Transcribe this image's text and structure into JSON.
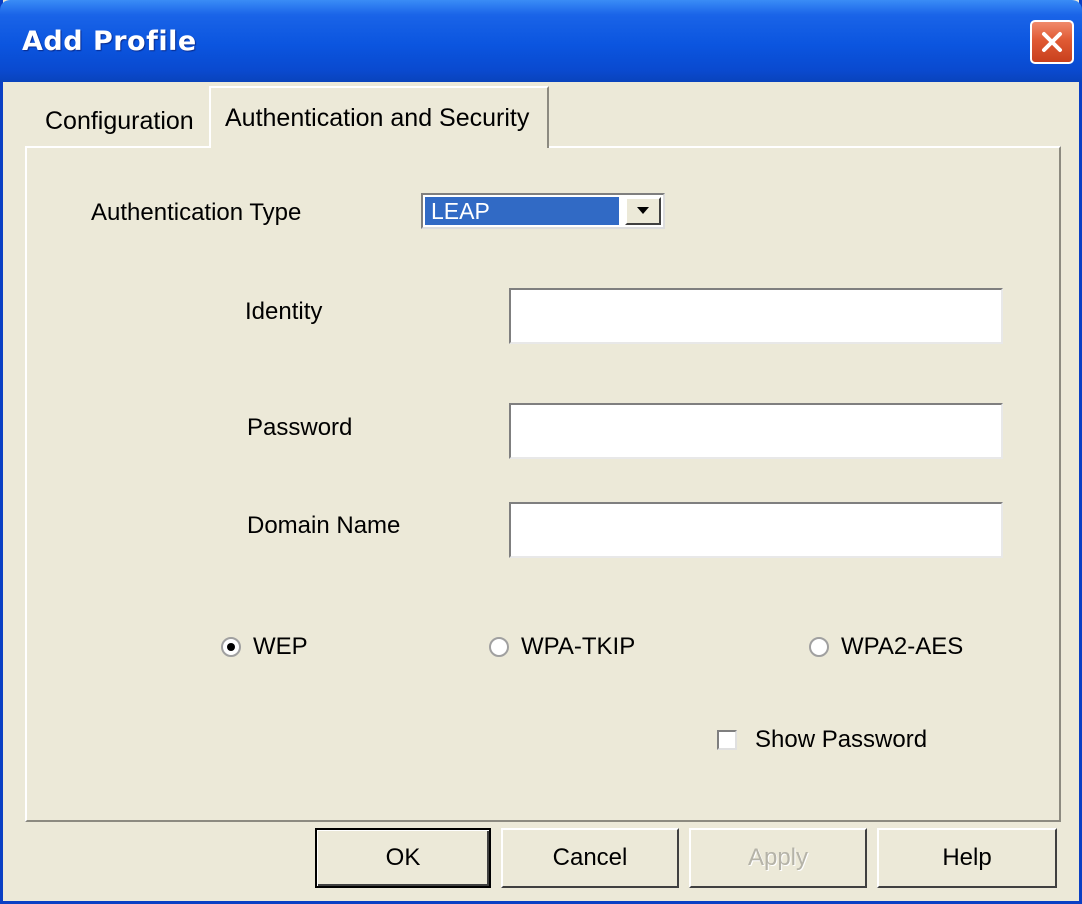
{
  "window": {
    "title": "Add Profile"
  },
  "tabs": [
    {
      "label": "Configuration",
      "active": false
    },
    {
      "label": "Authentication and Security",
      "active": true
    }
  ],
  "form": {
    "auth_type_label": "Authentication Type",
    "auth_type_value": "LEAP",
    "identity_label": "Identity",
    "identity_value": "",
    "password_label": "Password",
    "password_value": "",
    "domain_label": "Domain Name",
    "domain_value": "",
    "encryption_options": [
      {
        "label": "WEP",
        "checked": true
      },
      {
        "label": "WPA-TKIP",
        "checked": false
      },
      {
        "label": "WPA2-AES",
        "checked": false
      }
    ],
    "show_password_label": "Show Password",
    "show_password_checked": false
  },
  "buttons": {
    "ok": "OK",
    "cancel": "Cancel",
    "apply": "Apply",
    "help": "Help"
  },
  "colors": {
    "titlebar": "#0B55DF",
    "dialog_background": "#ECE9D8",
    "selection": "#316AC5",
    "close_button": "#E05A34"
  },
  "icons": {
    "close": "close-icon",
    "dropdown": "chevron-down-icon"
  }
}
